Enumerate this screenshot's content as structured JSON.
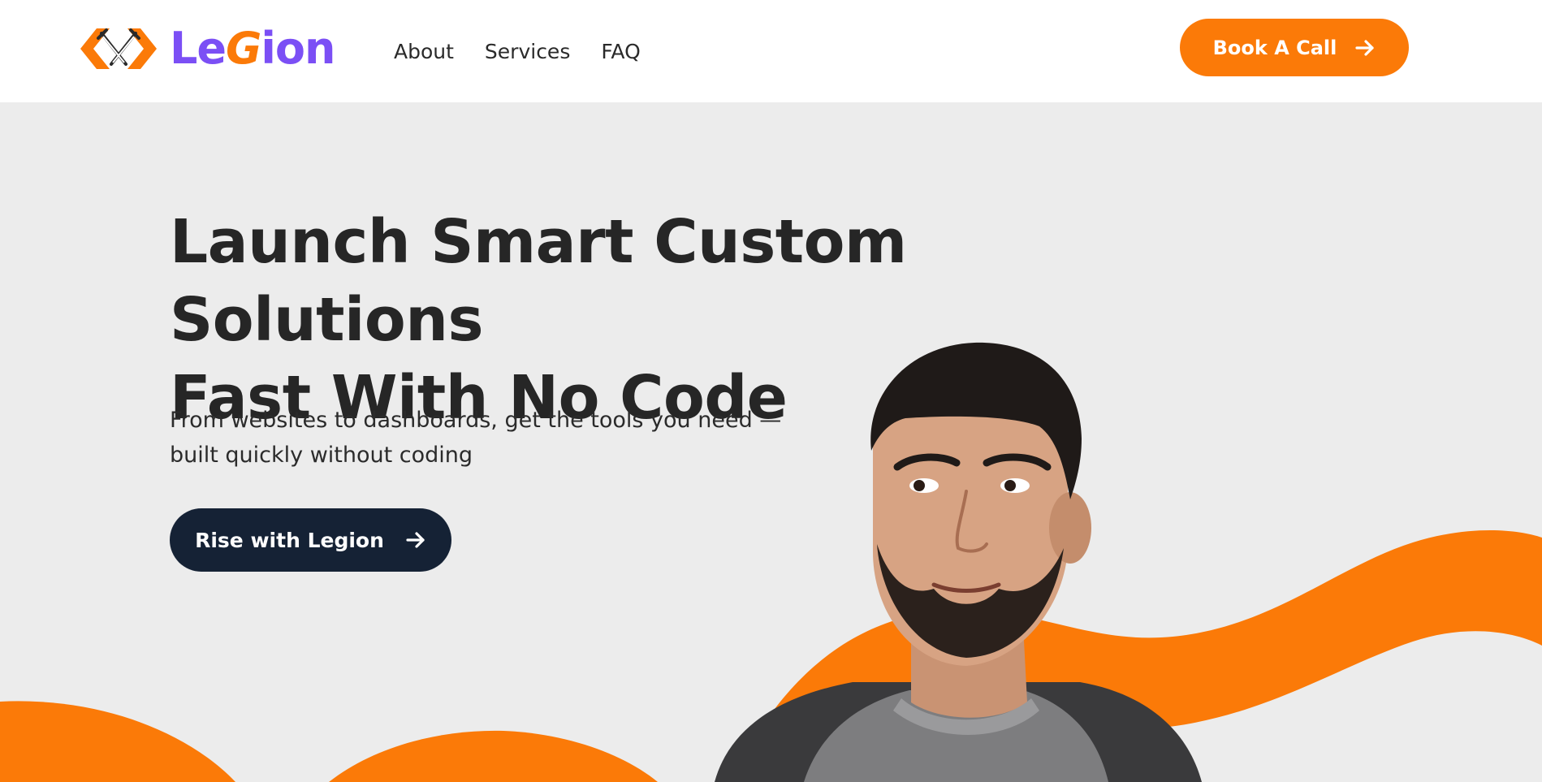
{
  "brand": {
    "name_prefix": "Le",
    "name_g": "G",
    "name_suffix": "ion",
    "primary_color": "#7b4ff5",
    "accent_color": "#fb7a08",
    "dark_color": "#152235"
  },
  "nav": {
    "items": [
      {
        "label": "About"
      },
      {
        "label": "Services"
      },
      {
        "label": "FAQ"
      }
    ]
  },
  "header_cta": {
    "label": "Book A Call",
    "icon": "arrow-right-icon"
  },
  "hero": {
    "title_line1": "Launch Smart Custom Solutions",
    "title_line2": "Fast With No Code",
    "subtitle_line1": "From websites to dashboards, get the tools you need —",
    "subtitle_line2": "built quickly without coding",
    "cta_label": "Rise with Legion",
    "cta_icon": "arrow-right-icon",
    "image": "founder-portrait"
  }
}
